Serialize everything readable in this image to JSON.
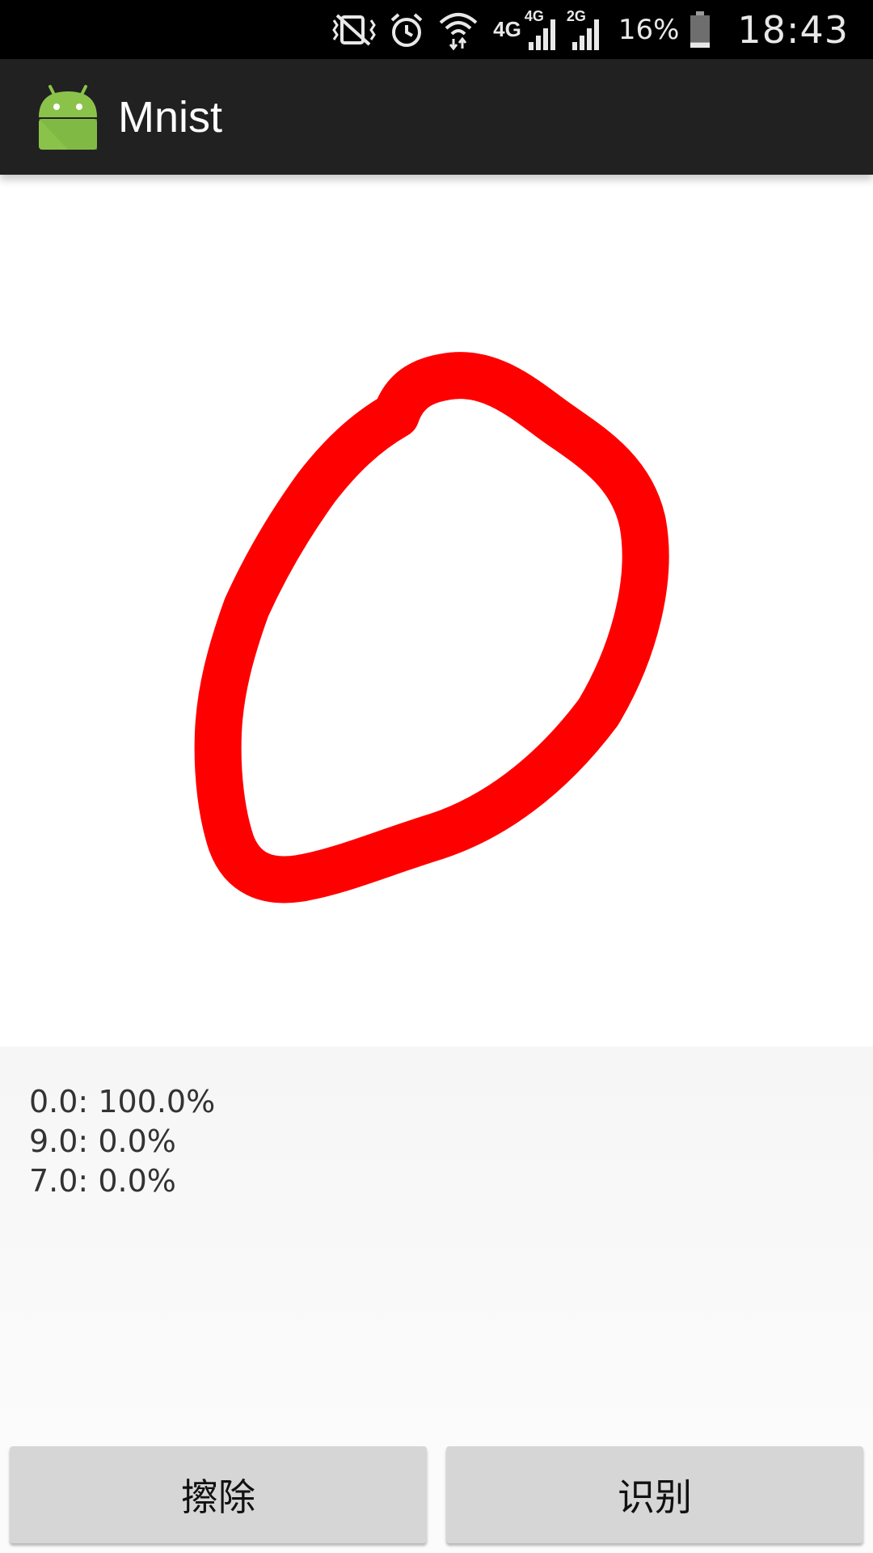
{
  "status_bar": {
    "network_label": "4G",
    "sim1_label": "4G",
    "sim2_label": "2G",
    "battery_percent": "16%",
    "battery_level": 0.16,
    "time": "18:43",
    "icons": [
      "vibrate-icon",
      "alarm-icon",
      "wifi-icon",
      "signal-sim1-icon",
      "signal-sim2-icon",
      "battery-icon"
    ]
  },
  "action_bar": {
    "title": "Mnist",
    "icon": "android-icon",
    "background": "#212121"
  },
  "canvas": {
    "stroke_color": "#ff0000",
    "background": "#ffffff"
  },
  "results": [
    {
      "text": "0.0: 100.0%"
    },
    {
      "text": "9.0: 0.0%"
    },
    {
      "text": "7.0: 0.0%"
    }
  ],
  "buttons": {
    "erase_label": "擦除",
    "recognize_label": "识别"
  }
}
